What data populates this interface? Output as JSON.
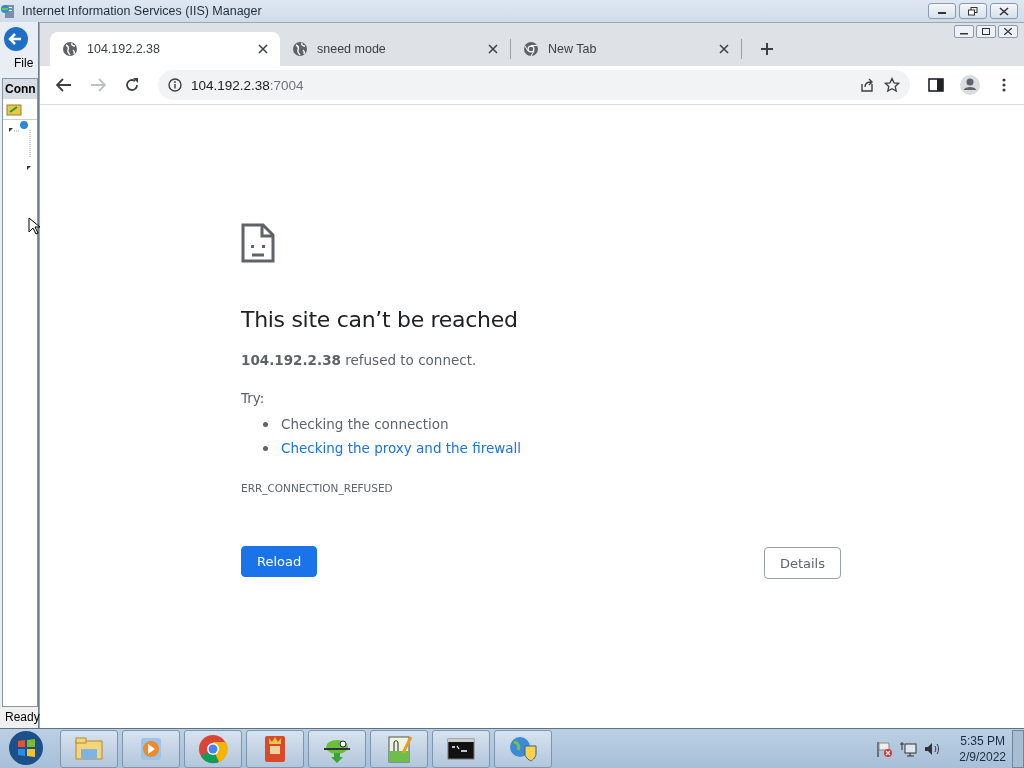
{
  "background_window": {
    "title": "Internet Information Services (IIS) Manager",
    "menu": [
      "File"
    ],
    "panel_header": "Conn",
    "status": "Ready"
  },
  "browser": {
    "tabs": [
      {
        "title": "104.192.2.38",
        "kind": "globe",
        "selected": true
      },
      {
        "title": "sneed mode",
        "kind": "globe",
        "selected": false
      },
      {
        "title": "New Tab",
        "kind": "chrome",
        "selected": false
      }
    ],
    "address": {
      "host": "104.192.2.38",
      "port": ":7004"
    },
    "error": {
      "heading": "This site can’t be reached",
      "message": "**104.192.2.38** refused to connect.",
      "try_label": "Try:",
      "suggestions": [
        {
          "text": "Checking the connection",
          "link": false
        },
        {
          "text": "Checking the proxy and the firewall",
          "link": true
        }
      ],
      "code": "ERR_CONNECTION_REFUSED",
      "buttons": [
        {
          "label": "Reload",
          "kind": "primary"
        },
        {
          "label": "Details",
          "kind": "secondary"
        }
      ]
    }
  },
  "taskbar": {
    "apps": [
      {
        "kind": "folder"
      },
      {
        "kind": "media"
      },
      {
        "kind": "chrome"
      },
      {
        "kind": "game"
      },
      {
        "kind": "snake"
      },
      {
        "kind": "notepad"
      },
      {
        "kind": "console"
      },
      {
        "kind": "network"
      }
    ],
    "clock": {
      "time": "5:35 PM",
      "date": "2/9/2022"
    }
  }
}
